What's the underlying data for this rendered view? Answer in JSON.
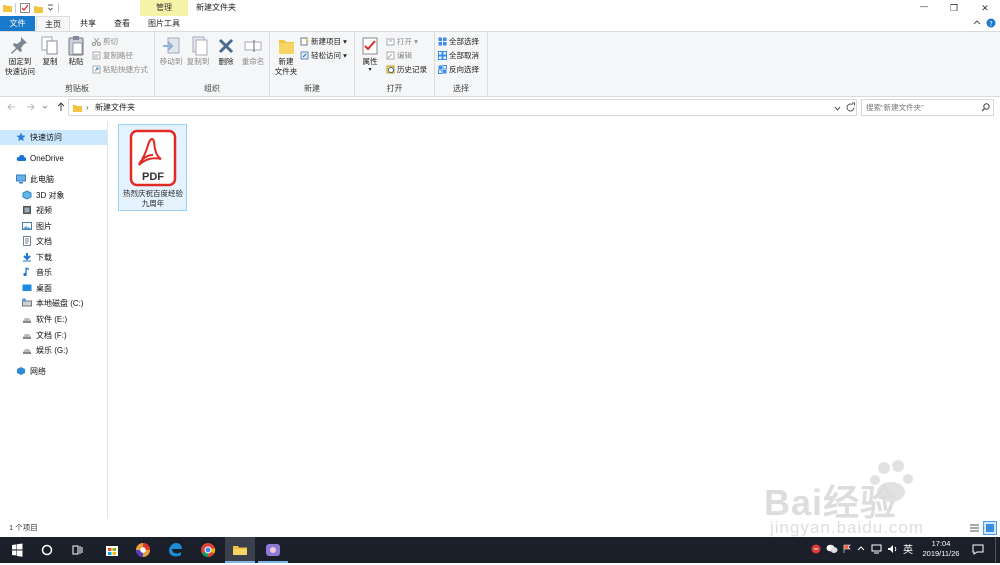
{
  "window": {
    "title": "新建文件夹",
    "context_tab_group": "管理",
    "buttons": {
      "minimize": "—",
      "maximize": "❐",
      "close": "✕"
    }
  },
  "tabs": [
    "文件",
    "主页",
    "共享",
    "查看",
    "图片工具"
  ],
  "ribbon": {
    "clipboard": {
      "name": "剪贴板",
      "pin": "固定到\n快速访问",
      "copy": "复制",
      "paste": "粘贴",
      "cut": "剪切",
      "copy_path": "复制路径",
      "paste_shortcut": "粘贴快捷方式"
    },
    "organize": {
      "name": "组织",
      "move_to": "移动到",
      "copy_to": "复制到",
      "delete": "删除",
      "rename": "重命名"
    },
    "new": {
      "name": "新建",
      "new_folder": "新建\n文件夹",
      "new_item": "新建项目 ▾",
      "easy_access": "轻松访问 ▾"
    },
    "open": {
      "name": "打开",
      "properties": "属性",
      "open": "打开 ▾",
      "edit": "编辑",
      "history": "历史记录"
    },
    "select": {
      "name": "选择",
      "select_all": "全部选择",
      "select_none": "全部取消",
      "invert": "反向选择"
    }
  },
  "address": {
    "path": "新建文件夹",
    "search_placeholder": "搜索\"新建文件夹\""
  },
  "sidebar": {
    "items": [
      {
        "label": "快速访问",
        "icon": "star-icon"
      },
      {
        "label": "OneDrive",
        "icon": "cloud-icon"
      },
      {
        "label": "此电脑",
        "icon": "pc-icon"
      },
      {
        "label": "3D 对象",
        "icon": "cube-icon"
      },
      {
        "label": "视频",
        "icon": "video-icon"
      },
      {
        "label": "图片",
        "icon": "picture-icon"
      },
      {
        "label": "文档",
        "icon": "document-icon"
      },
      {
        "label": "下载",
        "icon": "download-icon"
      },
      {
        "label": "音乐",
        "icon": "music-icon"
      },
      {
        "label": "桌面",
        "icon": "desktop-icon"
      },
      {
        "label": "本地磁盘 (C:)",
        "icon": "disk-icon"
      },
      {
        "label": "软件 (E:)",
        "icon": "drive-icon"
      },
      {
        "label": "文档 (F:)",
        "icon": "drive-icon"
      },
      {
        "label": "娱乐 (G:)",
        "icon": "drive-icon"
      },
      {
        "label": "网络",
        "icon": "network-icon"
      }
    ]
  },
  "files": [
    {
      "name": "热烈庆祝百度经验九周年",
      "type_badge": "PDF"
    }
  ],
  "status": {
    "count": "1 个项目"
  },
  "taskbar": {
    "time": "17:04",
    "date": "2019/11/26",
    "ime": "英"
  },
  "watermark": {
    "text": "Bai经验",
    "url": "jingyan.baidu.com"
  },
  "colors": {
    "accent": "#1979ca",
    "file_tab": "#1979ca",
    "context_tab": "#f6f3a8",
    "pdf_red": "#e12a26",
    "selection": "#cce8ff",
    "taskbar": "#1b1f2a"
  }
}
